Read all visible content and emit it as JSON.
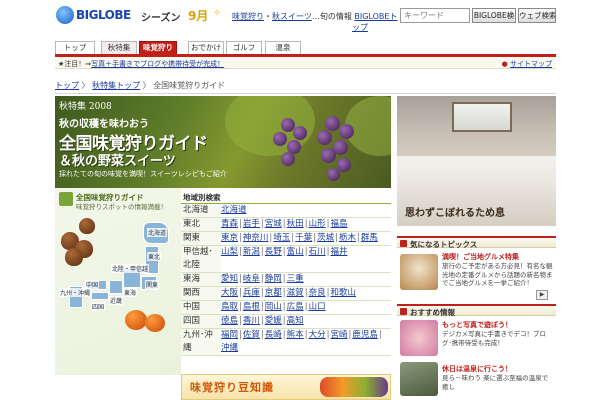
{
  "header": {
    "logo": "BIGLOBE",
    "season": "シーズン",
    "month": "9月",
    "link1": "味覚狩り",
    "link2": "秋スイーツ",
    "mid": "…旬の情報",
    "link3": "BIGLOBEト",
    "link3b": "ップ",
    "search_placeholder": "キーワード",
    "btn_biglobe": "BIGLOBE検",
    "btn_web": "ウェブ検索"
  },
  "tabs": [
    "トップ",
    "秋特集",
    "味覚狩り",
    "おでかけ",
    "ゴルフ",
    "温泉"
  ],
  "infobar": {
    "prefix": "★注目！⇒",
    "link": "写真＋手書きでブログや携帯待受が完成！",
    "sitemap": "サイトマップ"
  },
  "breadcrumb": {
    "home": "トップ",
    "section": "秋特集トップ",
    "current": "全国味覚狩りガイド"
  },
  "banner": {
    "issue": "秋特集 2008",
    "sub": "秋の収穫を味わおう",
    "title": "全国味覚狩りガイド",
    "title2": "＆秋の野菜スイーツ",
    "desc": "採れたての旬の味覚を満喫！スイーツレシピもご紹介"
  },
  "map": {
    "title": "全国味覚狩りガイド",
    "sub": "味覚狩りスポットの情報満載！",
    "labels": [
      "北海道",
      "東北",
      "北陸・甲信越",
      "関東",
      "東海",
      "近畿",
      "中国",
      "四国",
      "九州・沖縄"
    ]
  },
  "region": {
    "heading": "地域別検索",
    "rows": [
      {
        "name": "北海道",
        "links": [
          "北海道"
        ]
      },
      {
        "name": "東北",
        "links": [
          "青森",
          "岩手",
          "宮城",
          "秋田",
          "山形",
          "福島"
        ]
      },
      {
        "name": "関東",
        "links": [
          "東京",
          "神奈川",
          "埼玉",
          "千葉",
          "茨城",
          "栃木",
          "群馬"
        ]
      },
      {
        "name": "甲信越･北陸",
        "links": [
          "山梨",
          "新潟",
          "長野",
          "富山",
          "石川",
          "福井"
        ]
      },
      {
        "name": "東海",
        "links": [
          "愛知",
          "岐阜",
          "静岡",
          "三重"
        ]
      },
      {
        "name": "関西",
        "links": [
          "大阪",
          "兵庫",
          "京都",
          "滋賀",
          "奈良",
          "和歌山"
        ]
      },
      {
        "name": "中国",
        "links": [
          "鳥取",
          "島根",
          "岡山",
          "広島",
          "山口"
        ]
      },
      {
        "name": "四国",
        "links": [
          "徳島",
          "香川",
          "愛媛",
          "高知"
        ]
      },
      {
        "name": "九州･沖縄",
        "links": [
          "福岡",
          "佐賀",
          "長崎",
          "熊本",
          "大分",
          "宮崎",
          "鹿児島",
          "沖縄"
        ]
      }
    ]
  },
  "mame": {
    "text": "味覚狩り豆知識"
  },
  "onsen": {
    "caption": "思わずこぼれるため息"
  },
  "topics": {
    "heading": "気になるトピックス",
    "item": {
      "title": "満喫！ご当地グルメ特集",
      "body": "旅行のご予定がある方必見！有名な観光地の定番グルメから話題の新名物までご当地グルメを一挙ご紹介！"
    }
  },
  "recommend": {
    "heading": "おすすめ情報",
    "item1": {
      "title": "もっと写真で遊ぼう！",
      "body": "デジカメ写真に手書きでデコ！ブログ･携帯待受も完成！"
    },
    "item2": {
      "title": "休日は温泉に行こう！",
      "body": "見ら－味わう 楽に選ぶ至福の温泉で癒し"
    }
  },
  "colors": {
    "accent": "#c0201a",
    "link": "#1a3c9e",
    "brand": "#1a47a8"
  }
}
